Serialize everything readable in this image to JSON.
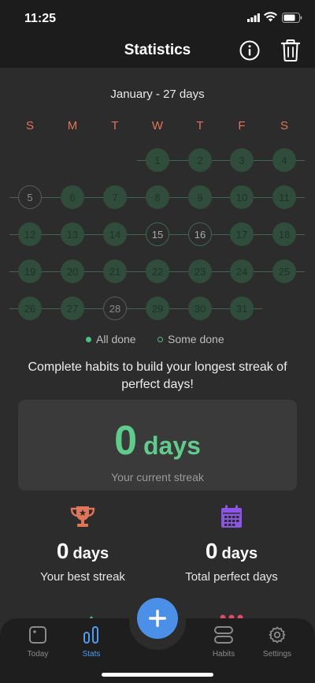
{
  "status_bar": {
    "time": "11:25"
  },
  "header": {
    "title": "Statistics"
  },
  "calendar": {
    "month_label": "January - 27 days",
    "weekdays": [
      "S",
      "M",
      "T",
      "W",
      "T",
      "F",
      "S"
    ],
    "days": [
      {
        "day": "1",
        "state": "full"
      },
      {
        "day": "2",
        "state": "full"
      },
      {
        "day": "3",
        "state": "full"
      },
      {
        "day": "4",
        "state": "full"
      },
      {
        "day": "5",
        "state": "none"
      },
      {
        "day": "6",
        "state": "full"
      },
      {
        "day": "7",
        "state": "full"
      },
      {
        "day": "8",
        "state": "full"
      },
      {
        "day": "9",
        "state": "full"
      },
      {
        "day": "10",
        "state": "full"
      },
      {
        "day": "11",
        "state": "full"
      },
      {
        "day": "12",
        "state": "full"
      },
      {
        "day": "13",
        "state": "full"
      },
      {
        "day": "14",
        "state": "full"
      },
      {
        "day": "15",
        "state": "some"
      },
      {
        "day": "16",
        "state": "some"
      },
      {
        "day": "17",
        "state": "full"
      },
      {
        "day": "18",
        "state": "full"
      },
      {
        "day": "19",
        "state": "full"
      },
      {
        "day": "20",
        "state": "full"
      },
      {
        "day": "21",
        "state": "full"
      },
      {
        "day": "22",
        "state": "full"
      },
      {
        "day": "23",
        "state": "full"
      },
      {
        "day": "24",
        "state": "full"
      },
      {
        "day": "25",
        "state": "full"
      },
      {
        "day": "26",
        "state": "full"
      },
      {
        "day": "27",
        "state": "full"
      },
      {
        "day": "28",
        "state": "none"
      },
      {
        "day": "29",
        "state": "full"
      },
      {
        "day": "30",
        "state": "full"
      },
      {
        "day": "31",
        "state": "full"
      }
    ],
    "first_weekday_index": 3
  },
  "legend": {
    "all_done": "All done",
    "some_done": "Some done"
  },
  "hint": "Complete habits to build your longest streak of perfect days!",
  "current_streak": {
    "value": "0",
    "unit": "days",
    "caption": "Your current streak"
  },
  "best_streak": {
    "value": "0",
    "unit": "days",
    "caption": "Your best streak"
  },
  "total_perfect": {
    "value": "0",
    "unit": "days",
    "caption": "Total perfect days"
  },
  "tabs": {
    "today": "Today",
    "stats": "Stats",
    "habits": "Habits",
    "settings": "Settings"
  },
  "colors": {
    "accent_green": "#5fcc8b",
    "accent_blue": "#4a90e8",
    "weekday_orange": "#e0755a",
    "trophy_orange": "#e0755a",
    "calendar_purple": "#8b55e6"
  }
}
